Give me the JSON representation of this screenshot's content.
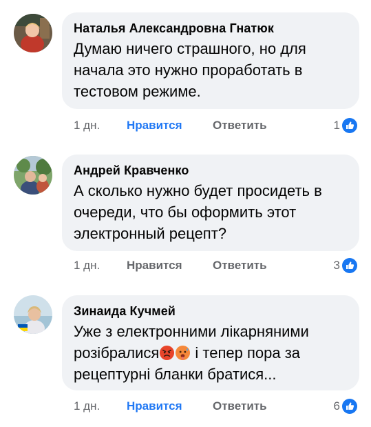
{
  "comments": [
    {
      "author": "Наталья Александровна Гнатюк",
      "text": "Думаю ничего страшного, но для начала это нужно проработать в тестовом режиме.",
      "time": "1 дн.",
      "like_label": "Нравится",
      "reply_label": "Ответить",
      "reaction_count": "1",
      "liked": true,
      "avatar_icon": "user-photo-avatar"
    },
    {
      "author": "Андрей Кравченко",
      "text": "А сколько нужно будет просидеть в очереди, что бы оформить этот электронный рецепт?",
      "time": "1 дн.",
      "like_label": "Нравится",
      "reply_label": "Ответить",
      "reaction_count": "3",
      "liked": false,
      "avatar_icon": "user-photo-avatar"
    },
    {
      "author": "Зинаида Кучмей",
      "text_part1": "Уже з електронними лікарняними розібралися",
      "text_part2": " і тепер пора за рецептурні бланки братися...",
      "emojis": [
        "angry-face-emoji",
        "sweating-hot-face-emoji"
      ],
      "time": "1 дн.",
      "like_label": "Нравится",
      "reply_label": "Ответить",
      "reaction_count": "6",
      "liked": true,
      "avatar_icon": "user-photo-avatar"
    }
  ],
  "colors": {
    "bubble": "#f0f2f5",
    "link_active": "#2078f4",
    "meta": "#65676b",
    "like_badge": "#1877f2"
  }
}
